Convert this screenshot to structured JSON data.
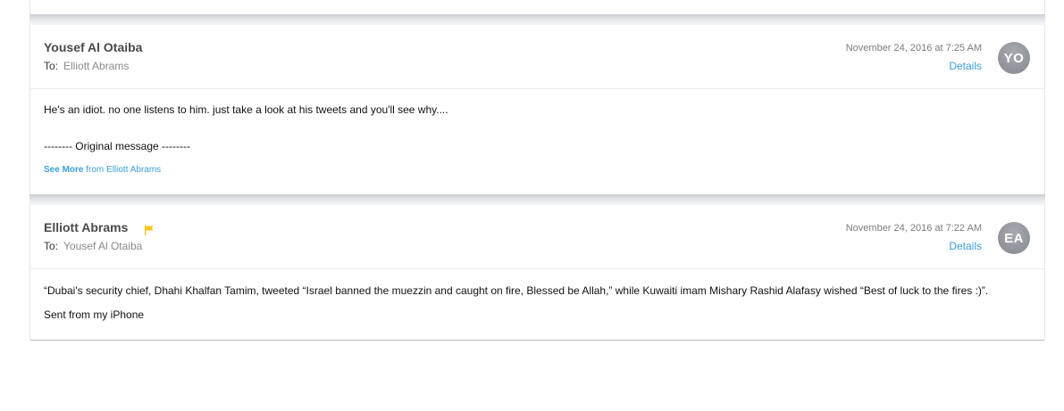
{
  "messages": [
    {
      "sender": "Yousef Al Otaiba",
      "to_label": "To:",
      "to": "Elliott Abrams",
      "date": "November 24, 2016 at 7:25 AM",
      "details_label": "Details",
      "avatar_initials": "YO",
      "body_line": "He's an idiot. no one listens to him. just take a look at his tweets and you'll see why....",
      "original_message": "-------- Original message --------",
      "see_more_label": "See More",
      "see_more_from": "from Elliott Abrams"
    },
    {
      "sender": "Elliott Abrams",
      "flagged": true,
      "flag_color": "#f5c518",
      "to_label": "To:",
      "to": "Yousef Al Otaiba",
      "date": "November 24, 2016 at 7:22 AM",
      "details_label": "Details",
      "avatar_initials": "EA",
      "body_line": "“Dubai's security chief, Dhahi Khalfan Tamim, tweeted “Israel banned the muezzin and caught on fire, Blessed be Allah,” while Kuwaiti imam Mishary Rashid Alafasy wished “Best of luck to the fires :)”.",
      "signature": "Sent from my iPhone"
    }
  ],
  "colors": {
    "link": "#3a9fd8",
    "sender": "#4a4a4a",
    "avatar": "#8e9197"
  }
}
